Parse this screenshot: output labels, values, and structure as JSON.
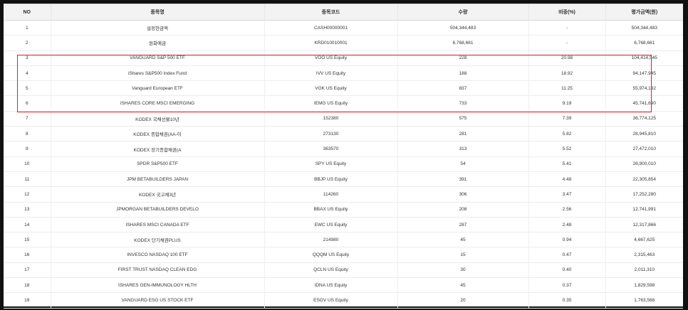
{
  "table": {
    "headers": [
      "NO",
      "종목명",
      "종목코드",
      "수량",
      "비중(%)",
      "평가금액(원)"
    ],
    "rows": [
      {
        "no": "1",
        "name": "설정현금액",
        "code": "CASH00000001",
        "qty": "504,344,483",
        "weight": "-",
        "value": "504,344,483"
      },
      {
        "no": "2",
        "name": "원화예금",
        "code": "KRD010010001",
        "qty": "6,768,661",
        "weight": "-",
        "value": "6,768,661"
      },
      {
        "no": "3",
        "name": "VANGUARD S&P 500 ETF",
        "code": "VOO US Equity",
        "qty": "228",
        "weight": "20.98",
        "value": "104,414,545"
      },
      {
        "no": "4",
        "name": "iShares S&P500 Index Fund",
        "code": "IVV US Equity",
        "qty": "188",
        "weight": "18.92",
        "value": "94,147,945"
      },
      {
        "no": "5",
        "name": "Vanguard European ETF",
        "code": "VGK US Equity",
        "qty": "837",
        "weight": "11.25",
        "value": "55,974,132"
      },
      {
        "no": "6",
        "name": "ISHARES CORE MSCI EMERGING",
        "code": "IEMG US Equity",
        "qty": "733",
        "weight": "9.19",
        "value": "45,741,690"
      },
      {
        "no": "7",
        "name": "KODEX 국채선물10년",
        "code": "152380",
        "qty": "575",
        "weight": "7.39",
        "value": "36,774,125"
      },
      {
        "no": "8",
        "name": "KODEX 종합채권(AA-이",
        "code": "273130",
        "qty": "281",
        "weight": "5.82",
        "value": "28,945,810"
      },
      {
        "no": "9",
        "name": "KODEX 장기종합채권(A",
        "code": "363570",
        "qty": "313",
        "weight": "5.52",
        "value": "27,472,010"
      },
      {
        "no": "10",
        "name": "SPDR S&P500 ETF",
        "code": "SPY US Equity",
        "qty": "54",
        "weight": "5.41",
        "value": "26,900,010"
      },
      {
        "no": "11",
        "name": "JPM BETABUILDERS JAPAN",
        "code": "BBJP US Equity",
        "qty": "391",
        "weight": "4.48",
        "value": "22,305,854"
      },
      {
        "no": "12",
        "name": "KODEX 국고채3년",
        "code": "114260",
        "qty": "306",
        "weight": "3.47",
        "value": "17,252,280"
      },
      {
        "no": "13",
        "name": "JPMORGAN BETABUILDERS DEVELO",
        "code": "BBAX US Equity",
        "qty": "208",
        "weight": "2.56",
        "value": "12,741,991"
      },
      {
        "no": "14",
        "name": "ISHARES MSCI CANADA ETF",
        "code": "EWC US Equity",
        "qty": "287",
        "weight": "2.48",
        "value": "12,317,866"
      },
      {
        "no": "15",
        "name": "KODEX 단기채권PLUS",
        "code": "214980",
        "qty": "45",
        "weight": "0.94",
        "value": "4,667,625"
      },
      {
        "no": "16",
        "name": "INVESCO NASDAQ 100 ETF",
        "code": "QQQM US Equity",
        "qty": "15",
        "weight": "0.47",
        "value": "2,315,463"
      },
      {
        "no": "17",
        "name": "FIRST TRUST NASDAQ CLEAN EDG",
        "code": "QCLN US Equity",
        "qty": "30",
        "weight": "0.40",
        "value": "2,011,310"
      },
      {
        "no": "18",
        "name": "ISHARES GEN-IMMUNOLOGY HLTH",
        "code": "IDNA US Equity",
        "qty": "45",
        "weight": "0.37",
        "value": "1,829,598"
      },
      {
        "no": "19",
        "name": "VANGUARD ESG US STOCK ETF",
        "code": "ESGV US Equity",
        "qty": "20",
        "weight": "0.35",
        "value": "1,763,568"
      }
    ]
  },
  "colors": {
    "highlight": "#e21b22",
    "header_bg": "#f3f3f3"
  }
}
